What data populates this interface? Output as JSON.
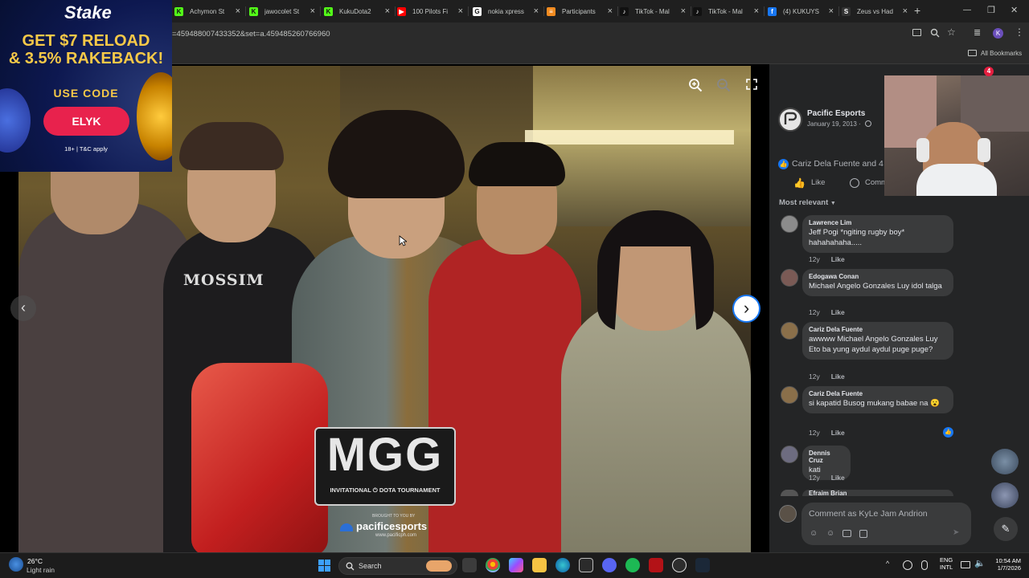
{
  "tabs": [
    {
      "title": "Achymon St",
      "fav": "K",
      "color": "#53fc18"
    },
    {
      "title": "jawocolet St",
      "fav": "K",
      "color": "#53fc18"
    },
    {
      "title": "KukuDota2",
      "fav": "K",
      "color": "#53fc18"
    },
    {
      "title": "100 Pilots Fi",
      "fav": "▶",
      "color": "#ff0000"
    },
    {
      "title": "nokia xpress",
      "fav": "G",
      "color": "#ffffff"
    },
    {
      "title": "Participants",
      "fav": "≡",
      "color": "#f28b20"
    },
    {
      "title": "TikTok - Mal",
      "fav": "♪",
      "color": "#111111"
    },
    {
      "title": "TikTok - Mal",
      "fav": "♪",
      "color": "#111111"
    },
    {
      "title": "(4) KUKUYS",
      "fav": "f",
      "color": "#1877f2"
    },
    {
      "title": "Zeus vs Had",
      "fav": "S",
      "color": "#333333"
    }
  ],
  "tab_close": "×",
  "new_tab": "+",
  "window_controls": {
    "min": "—",
    "max": "❐",
    "close": "✕"
  },
  "address": "=459488007433352&set=a.459485260766960",
  "profile_initial": "K",
  "all_bookmarks": "All Bookmarks",
  "ad": {
    "brand": "Stake",
    "headline1": "GET $7 RELOAD",
    "headline2": "& 3.5% RAKEBACK!",
    "use_code": "USE CODE",
    "code": "ELYK",
    "disclaimer": "18+ | T&C apply"
  },
  "photo": {
    "tshirt_text": "MOSSIM",
    "logo_main": "MGG",
    "logo_sub": "INVITATIONAL ⏻ DOTA TOURNAMENT",
    "brought_by": "BROUGHT TO YOU BY",
    "sponsor": "pacificesports",
    "sponsor_url": "www.pacificph.com"
  },
  "post": {
    "page_name": "Pacific Esports",
    "date": "January 19, 2013 ·",
    "reactions": "Cariz Dela Fuente and 4",
    "like": "Like",
    "comment": "Comm",
    "sort": "Most relevant"
  },
  "notification_count": "4",
  "comments": [
    {
      "name": "Lawrence Lim",
      "text": "Jeff Pogi *ngiting rugby boy* hahahahaha.....",
      "age": "12y",
      "like": "Like"
    },
    {
      "name": "Edogawa Conan",
      "text": "Michael Angelo Gonzales Luy idol talga",
      "age": "12y",
      "like": "Like"
    },
    {
      "name": "Cariz Dela Fuente",
      "text": "awwww Michael Angelo Gonzales Luy Eto ba yung aydul aydul puge puge?",
      "age": "12y",
      "like": "Like"
    },
    {
      "name": "Cariz Dela Fuente",
      "text": "si kapatid Busog mukang babae na 😮",
      "age": "12y",
      "like": "Like"
    },
    {
      "name": "Dennis Cruz",
      "text": "kati",
      "age": "12y",
      "like": "Like"
    },
    {
      "name": "Efraim Brian",
      "text": "",
      "age": "",
      "like": ""
    }
  ],
  "comment_placeholder": "Comment as KyLe Jam Andrion",
  "weather": {
    "temp": "26°C",
    "desc": "Light rain"
  },
  "taskbar_search": "Search",
  "tray": {
    "lang1": "ENG",
    "lang2": "INTL",
    "time": "10:54 AM",
    "date": "1/7/2026"
  },
  "colors": {
    "fb_blue": "#1877f2",
    "stake_red": "#e8224d",
    "panel_bg": "#242526"
  }
}
